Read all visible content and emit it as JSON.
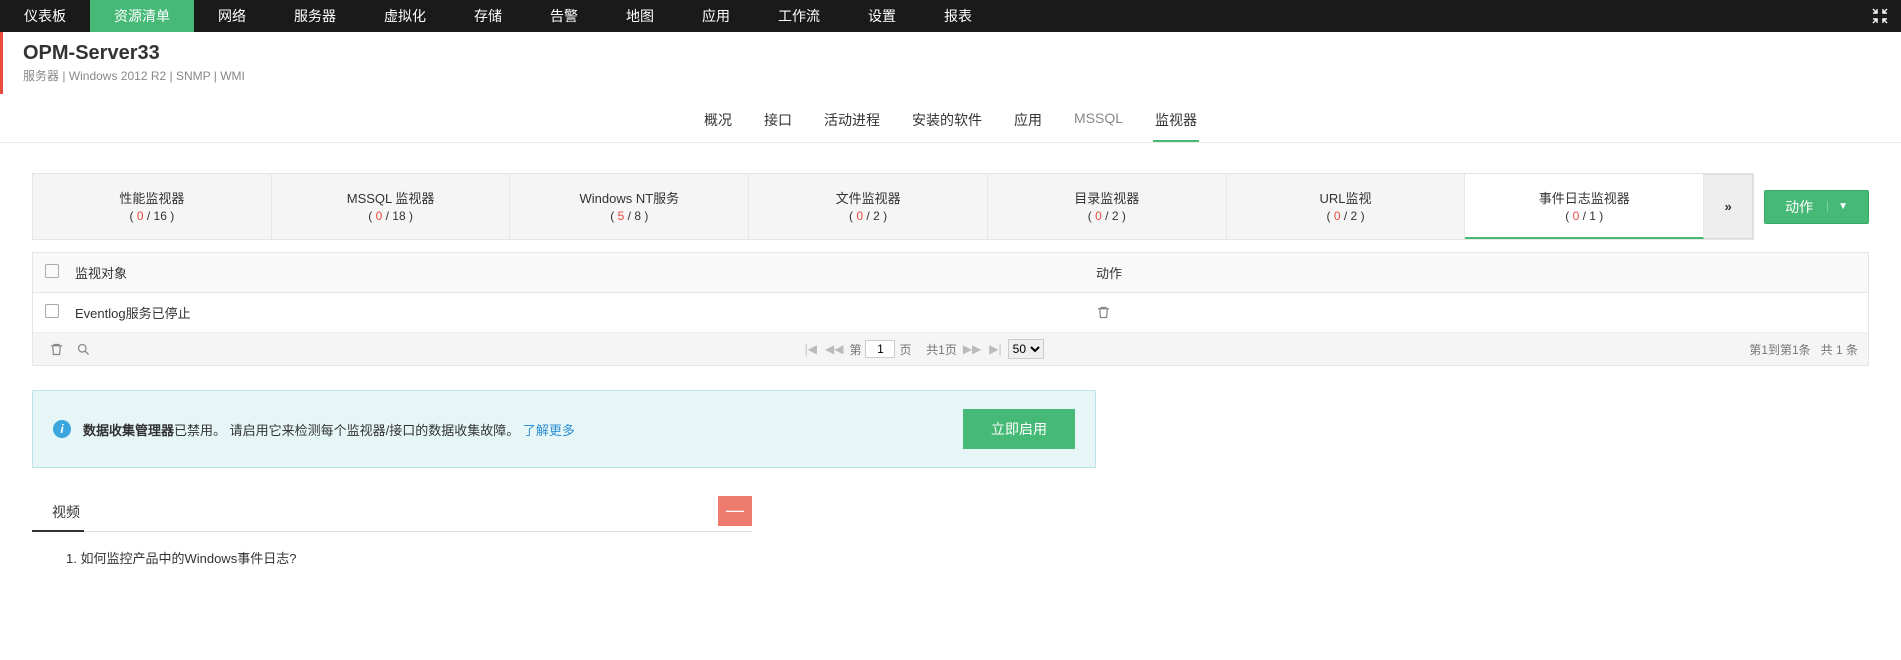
{
  "nav": {
    "items": [
      "仪表板",
      "资源清单",
      "网络",
      "服务器",
      "虚拟化",
      "存储",
      "告警",
      "地图",
      "应用",
      "工作流",
      "设置",
      "报表"
    ],
    "active_index": 1
  },
  "header": {
    "title": "OPM-Server33",
    "subtitle": "服务器 | Windows 2012 R2  | SNMP  | WMI"
  },
  "tabs": {
    "items": [
      "概况",
      "接口",
      "活动进程",
      "安装的软件",
      "应用",
      "MSSQL",
      "监视器"
    ],
    "active_index": 6
  },
  "monitor_tabs": [
    {
      "label": "性能监视器",
      "cur": 0,
      "total": 16
    },
    {
      "label": "MSSQL 监视器",
      "cur": 0,
      "total": 18
    },
    {
      "label": "Windows NT服务",
      "cur": 5,
      "total": 8
    },
    {
      "label": "文件监视器",
      "cur": 0,
      "total": 2
    },
    {
      "label": "目录监视器",
      "cur": 0,
      "total": 2
    },
    {
      "label": "URL监视",
      "cur": 0,
      "total": 2
    },
    {
      "label": "事件日志监视器",
      "cur": 0,
      "total": 1
    }
  ],
  "monitor_active_index": 6,
  "more_symbol": "»",
  "action_button": "动作",
  "table": {
    "header_name": "监视对象",
    "header_action": "动作",
    "rows": [
      {
        "name": "Eventlog服务已停止"
      }
    ]
  },
  "pager": {
    "prefix": "第",
    "page": "1",
    "suffix": "页",
    "total_pages": "共1页",
    "page_size": "50",
    "summary_range": "第1到第1条",
    "summary_total": "共 1 条"
  },
  "banner": {
    "bold": "数据收集管理器",
    "rest": "已禁用。 请启用它来检测每个监视器/接口的数据收集故障。",
    "link": "了解更多",
    "button": "立即启用"
  },
  "video": {
    "tab": "视频",
    "item": "1. 如何监控产品中的Windows事件日志?"
  }
}
